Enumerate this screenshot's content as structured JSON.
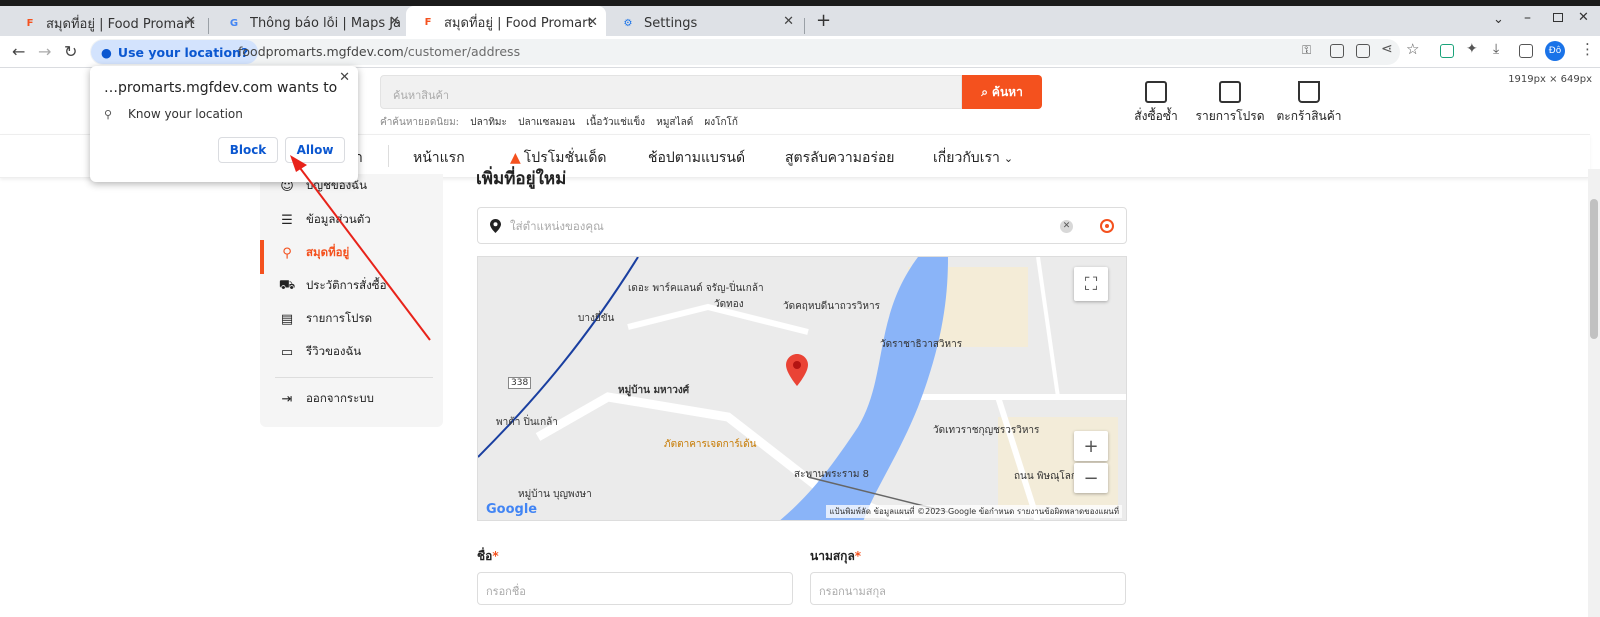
{
  "tabs": [
    {
      "title": "สมุดที่อยู่ | Food Promart",
      "icon": "food-promart-favicon",
      "active": false
    },
    {
      "title": "Thông báo lỗi | Maps Java",
      "icon": "google-favicon",
      "active": false
    },
    {
      "title": "สมุดที่อยู่ | Food Promart",
      "icon": "food-promart-favicon",
      "active": true
    },
    {
      "title": "Settings",
      "icon": "gear-icon",
      "active": false
    }
  ],
  "toolbar": {
    "location_chip": "Use your location?",
    "url_host": "foodpromarts.mgfdev.com",
    "url_path": "/customer/address",
    "profile_initials": "Đô"
  },
  "popup": {
    "title": "…promarts.mgfdev.com wants to",
    "permission": "Know your location",
    "block_label": "Block",
    "allow_label": "Allow"
  },
  "header": {
    "search_placeholder": "ค้นหาสินค้า",
    "search_button": "ค้นหา",
    "popular_label": "คำค้นหายอดนิยม:",
    "popular_terms": [
      "ปลาทิมะ",
      "ปลาแซลมอน",
      "เนื้อวัวแช่แข็ง",
      "หมูสไลด์",
      "ผงโกโก้"
    ],
    "links": {
      "reorder": "สั่งซื้อซ้ำ",
      "favorites": "รายการโปรด",
      "cart": "ตะกร้าสินค้า"
    },
    "size_readout": "1919px × 649px"
  },
  "nav": {
    "partial": "า",
    "items": [
      "หน้าแรก",
      "โปรโมชั่นเด็ด",
      "ช้อปตามแบรนด์",
      "สูตรลับความอร่อย",
      "เกี่ยวกับเรา"
    ]
  },
  "sidebar": {
    "items": [
      {
        "label": "บัญชีของฉัน",
        "icon": "user-icon"
      },
      {
        "label": "ข้อมูลส่วนตัว",
        "icon": "profile-list-icon"
      },
      {
        "label": "สมุดที่อยู่",
        "icon": "location-pin-icon"
      },
      {
        "label": "ประวัติการสั่งซื้อ",
        "icon": "cart-history-icon"
      },
      {
        "label": "รายการโปรด",
        "icon": "clipboard-icon"
      },
      {
        "label": "รีวิวของฉัน",
        "icon": "chat-icon"
      }
    ],
    "logout": "ออกจากระบบ",
    "active_index": 2
  },
  "main": {
    "title": "เพิ่มที่อยู่ใหม่",
    "address_placeholder": "ใส่ตำแหน่งของคุณ",
    "map": {
      "labels": [
        "หมู่บ้าน มหาวงศ์",
        "บางยี่ขัน",
        "วัดทอง",
        "วัดคฤหบดีนาถวรวิหาร",
        "วัดราชาธิวาสวิหาร",
        "วัดเทวราชกุญชรวรวิหาร",
        "สะพานพระราม 8",
        "หมู่บ้าน บุญพงษา",
        "พาต้า ปิ่นเกล้า",
        "ภัตตาคารเจดการ์เด้น",
        "ถนน พิษณุโลก",
        "เดอะ พาร์คแลนด์ จรัญ-ปิ่นเกล้า",
        "338"
      ],
      "footer": "แป้นพิมพ์ลัด   ข้อมูลแผนที่ ©2023 Google   ข้อกำหนด   รายงานข้อผิดพลาดของแผนที่",
      "google": "Google"
    },
    "first_name_label": "ชื่อ",
    "first_name_placeholder": "กรอกชื่อ",
    "last_name_label": "นามสกุล",
    "last_name_placeholder": "กรอกนามสกุล",
    "required_mark": "*"
  },
  "colors": {
    "brand": "#f4511e",
    "chrome_blue": "#0b57d0",
    "annotation_arrow": "#e8231a"
  }
}
